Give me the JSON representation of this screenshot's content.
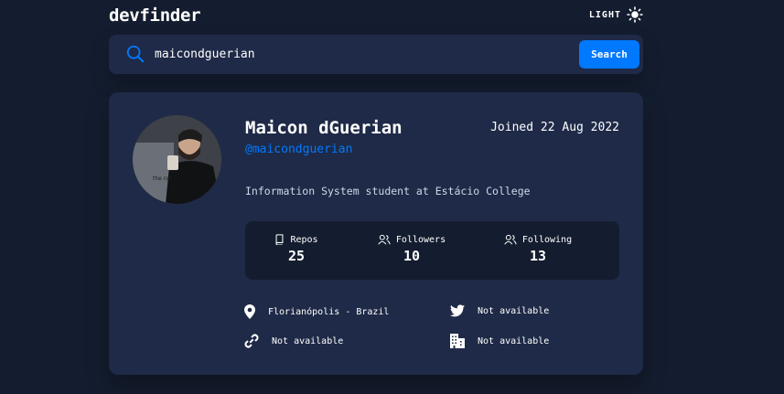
{
  "app": {
    "logo": "devfinder",
    "theme_label": "LIGHT"
  },
  "search": {
    "value": "maicondguerian",
    "button_label": "Search"
  },
  "profile": {
    "name": "Maicon dGuerian",
    "login": "@maicondguerian",
    "joined": "Joined 22 Aug 2022",
    "bio": "Information System student at Estácio College"
  },
  "stats": [
    {
      "label": "Repos",
      "value": "25",
      "icon": "repo-icon"
    },
    {
      "label": "Followers",
      "value": "10",
      "icon": "users-icon"
    },
    {
      "label": "Following",
      "value": "13",
      "icon": "users-icon"
    }
  ],
  "links": {
    "location": "Florianópolis - Brazil",
    "twitter": "Not available",
    "blog": "Not available",
    "company": "Not available"
  },
  "colors": {
    "background": "#141d2f",
    "card": "#1e2a47",
    "accent": "#0079ff"
  }
}
